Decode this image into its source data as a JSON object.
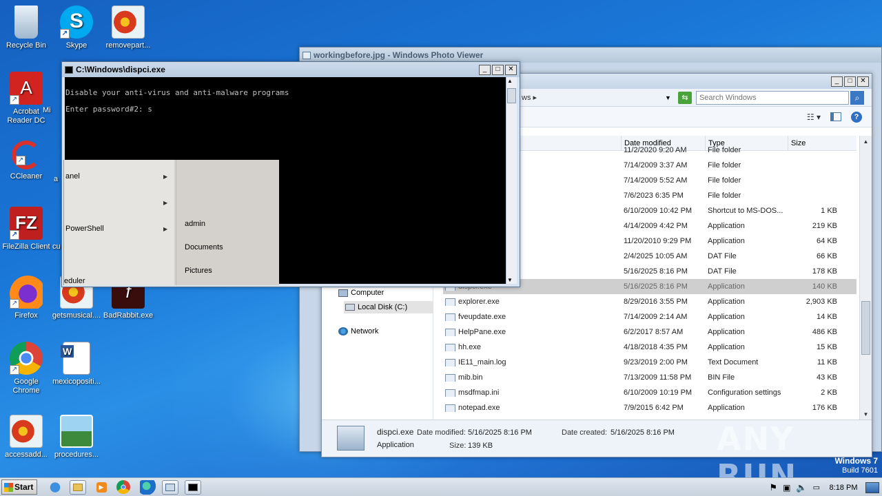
{
  "desktop": {
    "icons": [
      {
        "label": "Recycle Bin"
      },
      {
        "label": "Skype"
      },
      {
        "label": "removepart..."
      },
      {
        "label": "Acrobat Reader DC"
      },
      {
        "label": "Mi"
      },
      {
        "label": "CCleaner"
      },
      {
        "label": "a"
      },
      {
        "label": "FileZilla Client"
      },
      {
        "label": "cu"
      },
      {
        "label": "Firefox"
      },
      {
        "label": "getsmusical...."
      },
      {
        "label": "BadRabbit.exe"
      },
      {
        "label": "Google Chrome"
      },
      {
        "label": "mexicopositi..."
      },
      {
        "label": "accessadd..."
      },
      {
        "label": "procedures..."
      }
    ],
    "os_brand": "Windows 7",
    "build": "Build 7601",
    "watermark": "ANY RUN"
  },
  "photo_viewer": {
    "title": "workingbefore.jpg - Windows Photo Viewer"
  },
  "explorer": {
    "address_fragment": "ws",
    "search_placeholder": "Search Windows",
    "columns": [
      "Date modified",
      "Type",
      "Size"
    ],
    "nav": {
      "computer": "Computer",
      "local_disk": "Local Disk (C:)",
      "network": "Network"
    },
    "rows": [
      {
        "name": "",
        "date": "11/2/2020 9:20 AM",
        "type": "File folder",
        "size": ""
      },
      {
        "name": "",
        "date": "7/14/2009 3:37 AM",
        "type": "File folder",
        "size": ""
      },
      {
        "name": "",
        "date": "7/14/2009 5:52 AM",
        "type": "File folder",
        "size": ""
      },
      {
        "name": "",
        "date": "7/6/2023 6:35 PM",
        "type": "File folder",
        "size": ""
      },
      {
        "name": "",
        "date": "6/10/2009 10:42 PM",
        "type": "Shortcut to MS-DOS...",
        "size": "1 KB"
      },
      {
        "name": "",
        "date": "4/14/2009 4:42 PM",
        "type": "Application",
        "size": "219 KB"
      },
      {
        "name": "",
        "date": "11/20/2010 9:29 PM",
        "type": "Application",
        "size": "64 KB"
      },
      {
        "name": "",
        "date": "2/4/2025 10:05 AM",
        "type": "DAT File",
        "size": "66 KB"
      },
      {
        "name": "",
        "date": "5/16/2025 8:16 PM",
        "type": "DAT File",
        "size": "178 KB"
      },
      {
        "name": "dispci.exe",
        "date": "5/16/2025 8:16 PM",
        "type": "Application",
        "size": "140 KB"
      },
      {
        "name": "explorer.exe",
        "date": "8/29/2016 3:55 PM",
        "type": "Application",
        "size": "2,903 KB"
      },
      {
        "name": "fveupdate.exe",
        "date": "7/14/2009 2:14 AM",
        "type": "Application",
        "size": "14 KB"
      },
      {
        "name": "HelpPane.exe",
        "date": "6/2/2017 8:57 AM",
        "type": "Application",
        "size": "486 KB"
      },
      {
        "name": "hh.exe",
        "date": "4/18/2018 4:35 PM",
        "type": "Application",
        "size": "15 KB"
      },
      {
        "name": "IE11_main.log",
        "date": "9/23/2019 2:00 PM",
        "type": "Text Document",
        "size": "11 KB"
      },
      {
        "name": "mib.bin",
        "date": "7/13/2009 11:58 PM",
        "type": "BIN File",
        "size": "43 KB"
      },
      {
        "name": "msdfmap.ini",
        "date": "6/10/2009 10:19 PM",
        "type": "Configuration settings",
        "size": "2 KB"
      },
      {
        "name": "notepad.exe",
        "date": "7/9/2015 6:42 PM",
        "type": "Application",
        "size": "176 KB"
      }
    ],
    "details": {
      "name": "dispci.exe",
      "kind": "Application",
      "date_modified_label": "Date modified:",
      "date_modified": "5/16/2025 8:16 PM",
      "date_created_label": "Date created:",
      "date_created": "5/16/2025 8:16 PM",
      "size_label": "Size:",
      "size": "139 KB"
    }
  },
  "cmd": {
    "title": "C:\\Windows\\dispci.exe",
    "line1": "Disable your anti-virus and anti-malware programs",
    "line2": "Enter password#2: s"
  },
  "start_menu": {
    "left_items": [
      "anel",
      "",
      "PowerShell",
      "eduler"
    ],
    "right_items": [
      "admin",
      "Documents",
      "Pictures"
    ]
  },
  "taskbar": {
    "start_label": "Start",
    "time": "8:18 PM"
  }
}
